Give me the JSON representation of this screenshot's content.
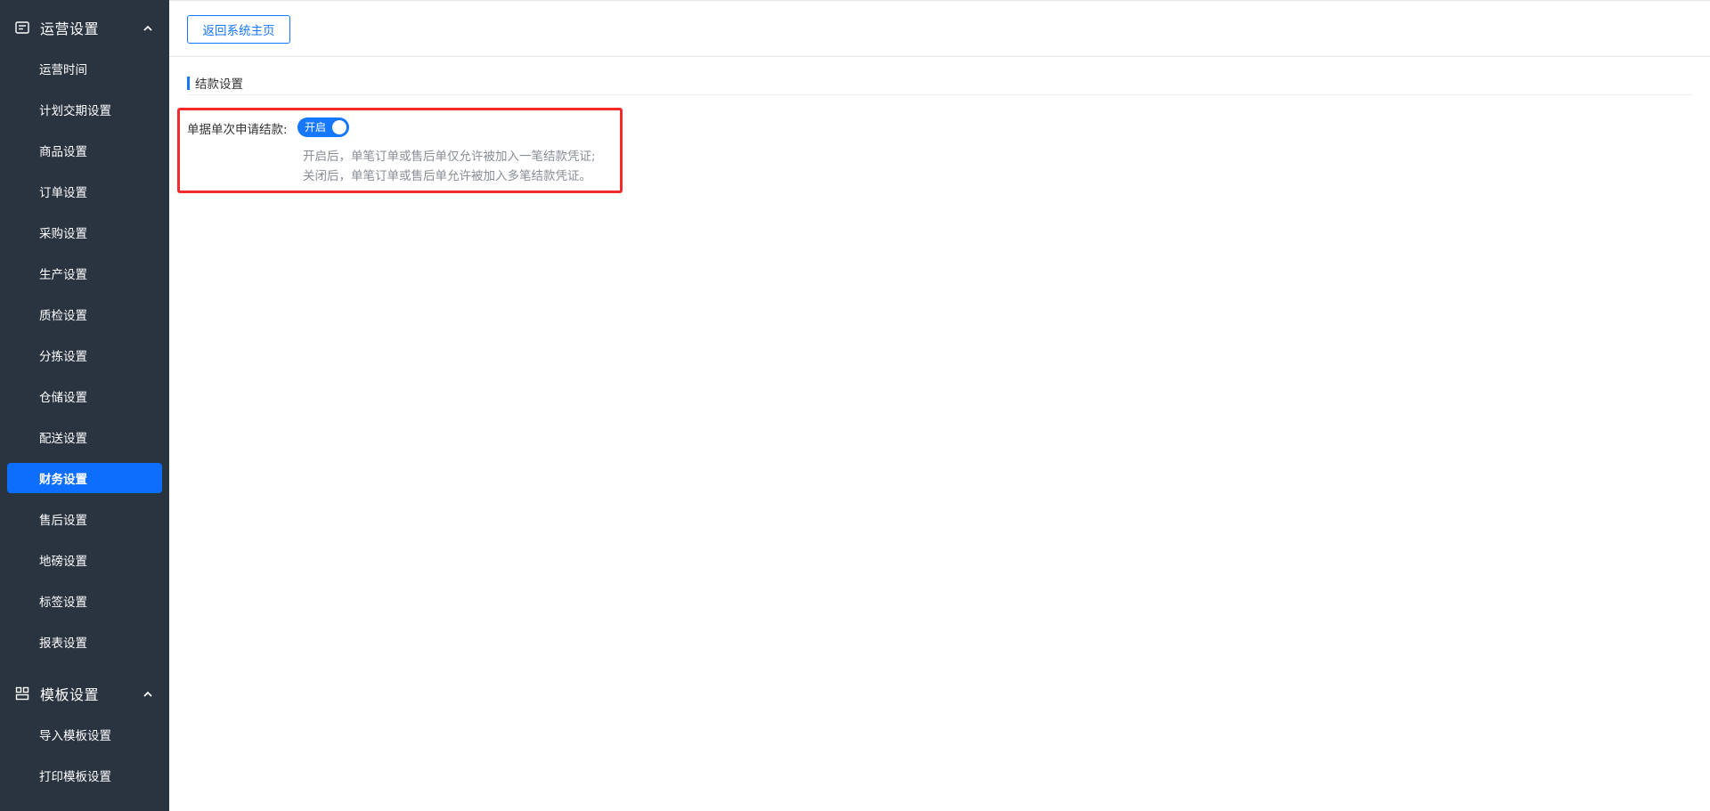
{
  "sidebar": {
    "groups": [
      {
        "label": "运营设置",
        "icon": "list-card-icon",
        "expanded": true,
        "items": [
          {
            "label": "运营时间"
          },
          {
            "label": "计划交期设置"
          },
          {
            "label": "商品设置"
          },
          {
            "label": "订单设置"
          },
          {
            "label": "采购设置"
          },
          {
            "label": "生产设置"
          },
          {
            "label": "质检设置"
          },
          {
            "label": "分拣设置"
          },
          {
            "label": "仓储设置"
          },
          {
            "label": "配送设置"
          },
          {
            "label": "财务设置",
            "active": true
          },
          {
            "label": "售后设置"
          },
          {
            "label": "地磅设置"
          },
          {
            "label": "标签设置"
          },
          {
            "label": "报表设置"
          }
        ]
      },
      {
        "label": "模板设置",
        "icon": "layout-blocks-icon",
        "expanded": true,
        "items": [
          {
            "label": "导入模板设置"
          },
          {
            "label": "打印模板设置"
          }
        ]
      }
    ]
  },
  "header": {
    "back_button_label": "返回系统主页"
  },
  "settlement": {
    "section_title": "结款设置",
    "field_label": "单据单次申请结款:",
    "switch": {
      "label": "开启",
      "checked": true
    },
    "hint_line_1": "开启后，单笔订单或售后单仅允许被加入一笔结款凭证;",
    "hint_line_2": "关闭后，单笔订单或售后单允许被加入多笔结款凭证。"
  },
  "colors": {
    "sidebar_bg": "#2a3340",
    "accent": "#1677ff",
    "active_item_bg": "#0d6efd",
    "highlight_border": "#f52a2a"
  }
}
